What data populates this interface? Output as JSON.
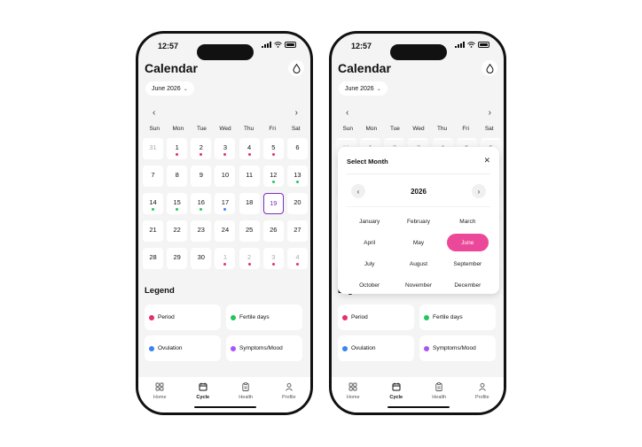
{
  "status": {
    "time": "12:57"
  },
  "header": {
    "title": "Calendar",
    "month_label": "June 2026",
    "drop_icon": "drop-icon"
  },
  "nav": {
    "prev": "‹",
    "next": "›"
  },
  "weekdays": [
    "Sun",
    "Mon",
    "Tue",
    "Wed",
    "Thu",
    "Fri",
    "Sat"
  ],
  "days": [
    {
      "n": "31",
      "muted": true,
      "dot": ""
    },
    {
      "n": "1",
      "muted": false,
      "dot": "period"
    },
    {
      "n": "2",
      "muted": false,
      "dot": "period"
    },
    {
      "n": "3",
      "muted": false,
      "dot": "period"
    },
    {
      "n": "4",
      "muted": false,
      "dot": "period"
    },
    {
      "n": "5",
      "muted": false,
      "dot": "period"
    },
    {
      "n": "6",
      "muted": false,
      "dot": ""
    },
    {
      "n": "7",
      "muted": false,
      "dot": ""
    },
    {
      "n": "8",
      "muted": false,
      "dot": ""
    },
    {
      "n": "9",
      "muted": false,
      "dot": ""
    },
    {
      "n": "10",
      "muted": false,
      "dot": ""
    },
    {
      "n": "11",
      "muted": false,
      "dot": ""
    },
    {
      "n": "12",
      "muted": false,
      "dot": "fertile"
    },
    {
      "n": "13",
      "muted": false,
      "dot": "fertile"
    },
    {
      "n": "14",
      "muted": false,
      "dot": "fertile"
    },
    {
      "n": "15",
      "muted": false,
      "dot": "fertile"
    },
    {
      "n": "16",
      "muted": false,
      "dot": "fertile"
    },
    {
      "n": "17",
      "muted": false,
      "dot": "ovulation"
    },
    {
      "n": "18",
      "muted": false,
      "dot": ""
    },
    {
      "n": "19",
      "muted": false,
      "dot": "",
      "selected": true
    },
    {
      "n": "20",
      "muted": false,
      "dot": ""
    },
    {
      "n": "21",
      "muted": false,
      "dot": ""
    },
    {
      "n": "22",
      "muted": false,
      "dot": ""
    },
    {
      "n": "23",
      "muted": false,
      "dot": ""
    },
    {
      "n": "24",
      "muted": false,
      "dot": ""
    },
    {
      "n": "25",
      "muted": false,
      "dot": ""
    },
    {
      "n": "26",
      "muted": false,
      "dot": ""
    },
    {
      "n": "27",
      "muted": false,
      "dot": ""
    },
    {
      "n": "28",
      "muted": false,
      "dot": ""
    },
    {
      "n": "29",
      "muted": false,
      "dot": ""
    },
    {
      "n": "30",
      "muted": false,
      "dot": ""
    },
    {
      "n": "1",
      "muted": true,
      "dot": "period"
    },
    {
      "n": "2",
      "muted": true,
      "dot": "period"
    },
    {
      "n": "3",
      "muted": true,
      "dot": "period"
    },
    {
      "n": "4",
      "muted": true,
      "dot": "period"
    }
  ],
  "legend": {
    "title": "Legend",
    "items": [
      {
        "label": "Period",
        "key": "period"
      },
      {
        "label": "Fertile days",
        "key": "fertile"
      },
      {
        "label": "Ovulation",
        "key": "ovulation"
      },
      {
        "label": "Symptoms/Mood",
        "key": "symptoms"
      }
    ]
  },
  "colors": {
    "period": "#e1306c",
    "fertile": "#22c55e",
    "ovulation": "#3b82f6",
    "symptoms": "#a855f7",
    "selected_border": "#7b2fbe",
    "month_selected": "#ec4899"
  },
  "tabs": [
    {
      "label": "Home",
      "icon": "home-grid-icon",
      "active": false
    },
    {
      "label": "Cycle",
      "icon": "calendar-icon",
      "active": true
    },
    {
      "label": "Health",
      "icon": "clipboard-icon",
      "active": false
    },
    {
      "label": "Profile",
      "icon": "profile-icon",
      "active": false
    }
  ],
  "month_picker": {
    "title": "Select Month",
    "close": "✕",
    "year": "2026",
    "months": [
      "January",
      "February",
      "March",
      "April",
      "May",
      "June",
      "July",
      "August",
      "September",
      "October",
      "November",
      "December"
    ],
    "selected": "June"
  }
}
